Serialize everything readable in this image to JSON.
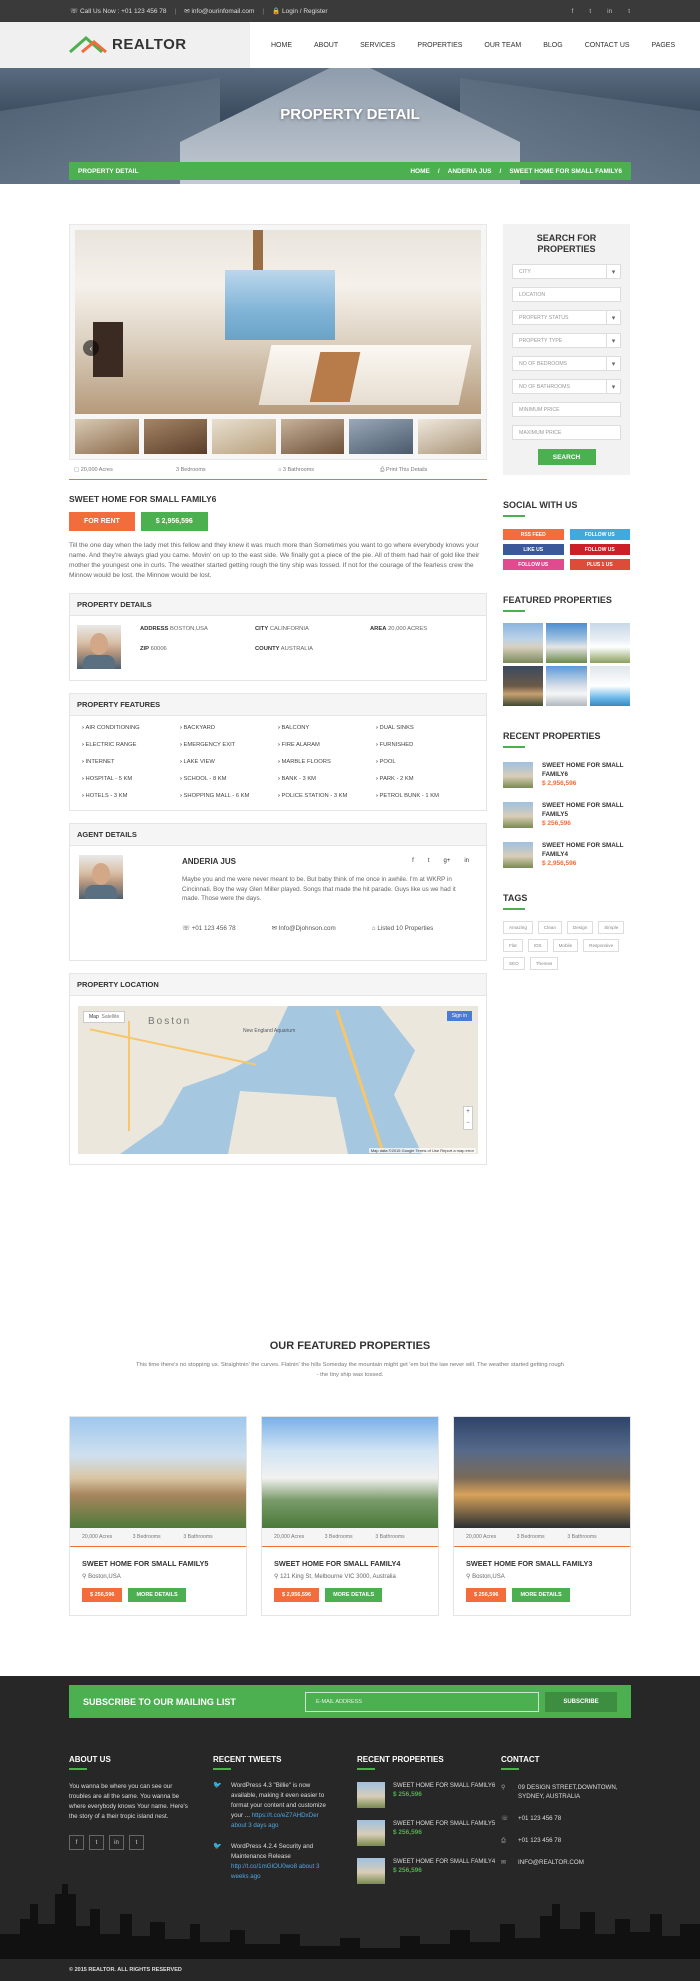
{
  "topbar": {
    "phone": "Call Us Now : +01 123 456 78",
    "email": "info@ourinfomail.com",
    "login": "Login / Register"
  },
  "brand": {
    "name": "REALTOR",
    "green": "#4caf50",
    "orange": "#f36c3c"
  },
  "nav": [
    "HOME",
    "ABOUT",
    "SERVICES",
    "PROPERTIES",
    "OUR TEAM",
    "BLOG",
    "CONTACT US",
    "PAGES"
  ],
  "hero": {
    "title": "PROPERTY DETAIL",
    "bar_label": "PROPERTY DETAIL",
    "breadcrumb": [
      "HOME",
      "ANDERIA JUS",
      "SWEET HOME FOR SMALL FAMILY6"
    ]
  },
  "property": {
    "meta": [
      "20,000 Acres",
      "3 Bedrooms",
      "3 Bathrooms",
      "Print This Details"
    ],
    "title": "SWEET HOME FOR SMALL FAMILY6",
    "status": "FOR RENT",
    "price": "$ 2,956,596",
    "description": "Till the one day when the lady met this fellow and they knew it was much more than Sometimes you want to go where everybody knows your name. And they're always glad you came. Movin' on up to the east side. We finally got a piece of the pie. All of them had hair of gold like their mother the youngest one in curls. The weather started getting rough the tiny ship was tossed. If not for the courage of the fearless crew the Minnow would be lost. the Minnow would be lost."
  },
  "details": {
    "heading": "PROPERTY DETAILS",
    "items": [
      {
        "k": "ADDRESS",
        "v": "BOSTON,USA"
      },
      {
        "k": "CITY",
        "v": "CALINFORNIA"
      },
      {
        "k": "AREA",
        "v": "20,000 ACRES"
      },
      {
        "k": "ZIP",
        "v": "60006"
      },
      {
        "k": "COUNTY",
        "v": "AUSTRALIA"
      }
    ]
  },
  "features": {
    "heading": "PROPERTY FEATURES",
    "items": [
      "AIR CONDITIONING",
      "BACKYARD",
      "BALCONY",
      "DUAL SINKS",
      "ELECTRIC RANGE",
      "EMERGENCY EXIT",
      "FIRE ALARAM",
      "FURNISHED",
      "INTERNET",
      "LAKE VIEW",
      "MARBLE FLOORS",
      "POOL",
      "HOSPITAL - 5 KM",
      "SCHOOL - 8 KM",
      "BANK - 3 KM",
      "PARK - 2 KM",
      "HOTELS - 3 KM",
      "SHOPPING MALL - 6 KM",
      "POLICE STATION - 3 KM",
      "PETROL BUNK - 1 KM"
    ]
  },
  "agent": {
    "heading": "AGENT DETAILS",
    "name": "ANDERIA JUS",
    "social": [
      "f",
      "t",
      "g+",
      "in"
    ],
    "bio": "Maybe you and me were never meant to be. But baby think of me once in awhile. I'm at WKRP in Cincinnati. Boy the way Glen Miller played. Songs that made the hit parade. Guys like us we had it made. Those were the days.",
    "phone": "+01 123 456 78",
    "email": "Info@Djohnson.com",
    "listed": "Listed 10 Properties"
  },
  "location": {
    "heading": "PROPERTY LOCATION",
    "map_btn": "Map",
    "sat_btn": "Satellite",
    "sign_in": "Sign in",
    "city_label": "Boston",
    "place": "New England Aquarium",
    "attribution": "Map data ©2015 Google  Terms of Use  Report a map error"
  },
  "search": {
    "title": "SEARCH FOR PROPERTIES",
    "fields": [
      {
        "label": "CITY",
        "select": true
      },
      {
        "label": "LOCATION",
        "select": false
      },
      {
        "label": "PROPERTY STATUS",
        "select": true
      },
      {
        "label": "PROPERTY TYPE",
        "select": true
      },
      {
        "label": "NO OF BEDROOMS",
        "select": true
      },
      {
        "label": "NO OF BATHROOMS",
        "select": true
      },
      {
        "label": "MINIMUM PRICE",
        "select": false
      },
      {
        "label": "MAXIMUM PRICE",
        "select": false
      }
    ],
    "button": "SEARCH"
  },
  "social": {
    "heading": "SOCIAL WITH US",
    "items": [
      {
        "label": "RSS FEED",
        "color": "#f36c3c"
      },
      {
        "label": "FOLLOW US",
        "color": "#3fa9e0"
      },
      {
        "label": "LIKE US",
        "color": "#3b5998"
      },
      {
        "label": "FOLLOW US",
        "color": "#cb2027"
      },
      {
        "label": "FOLLOW US",
        "color": "#e04a8f"
      },
      {
        "label": "PLUS 1 US",
        "color": "#dd4b39"
      }
    ]
  },
  "featured_side": {
    "heading": "FEATURED PROPERTIES"
  },
  "recent": {
    "heading": "RECENT PROPERTIES",
    "items": [
      {
        "title": "SWEET HOME FOR SMALL FAMILY6",
        "price": "$ 2,956,596"
      },
      {
        "title": "SWEET HOME FOR SMALL FAMILY5",
        "price": "$ 256,596"
      },
      {
        "title": "SWEET HOME FOR SMALL FAMILY4",
        "price": "$ 2,956,596"
      }
    ]
  },
  "tags": {
    "heading": "TAGS",
    "items": [
      "Amazing",
      "Clean",
      "Design",
      "Simple",
      "Flat",
      "IOS",
      "Mobile",
      "Responsive",
      "SEO",
      "Themes"
    ]
  },
  "our_featured": {
    "heading": "OUR FEATURED PROPERTIES",
    "intro": "This time there's no stopping us. Straightnin' the curves. Flatnin' the hills Someday the mountain might get 'em but the law never will. The weather started getting rough - the tiny ship was tossed.",
    "cards": [
      {
        "meta": [
          "20,000 Acres",
          "3 Bedrooms",
          "3 Bathrooms"
        ],
        "title": "SWEET HOME FOR SMALL FAMILY5",
        "address": "Boston,USA",
        "price": "$ 256,596",
        "more": "MORE DETAILS"
      },
      {
        "meta": [
          "20,000 Acres",
          "3 Bedrooms",
          "3 Bathrooms"
        ],
        "title": "SWEET HOME FOR SMALL FAMILY4",
        "address": "121 King St, Melbourne VIC 3000, Australia",
        "price": "$ 2,956,596",
        "more": "MORE DETAILS"
      },
      {
        "meta": [
          "20,000 Acres",
          "3 Bedrooms",
          "3 Bathrooms"
        ],
        "title": "SWEET HOME FOR SMALL FAMILY3",
        "address": "Boston,USA",
        "price": "$ 256,596",
        "more": "MORE DETAILS"
      }
    ]
  },
  "footer": {
    "subscribe_title": "SUBSCRIBE TO OUR MAILING LIST",
    "email_placeholder": "E-MAIL ADDRESS",
    "subscribe_btn": "SUBSCRIBE",
    "about_heading": "ABOUT US",
    "about_text": "You wanna be where you can see our troubles are all the same. You wanna be where everybody knows Your name. Here's the story of a their tropic island nest.",
    "social": [
      "f",
      "t",
      "in",
      "t"
    ],
    "tweets_heading": "RECENT TWEETS",
    "tweets": [
      {
        "text": "WordPress 4.3 \"Billie\" is now available, making it even easier to format your content and customize your ... ",
        "link": "https://t.co/eZ7AHDxDer",
        "time": "about 3 days ago"
      },
      {
        "text": "WordPress 4.2.4 Security and Maintenance Release ",
        "link": "http://t.co/1mGlOU0wo8",
        "time": "about 3 weeks ago"
      }
    ],
    "recent_heading": "RECENT PROPERTIES",
    "recent": [
      {
        "title": "SWEET HOME FOR SMALL FAMILY6",
        "price": "$ 256,596"
      },
      {
        "title": "SWEET HOME FOR SMALL FAMILY5",
        "price": "$ 256,596"
      },
      {
        "title": "SWEET HOME FOR SMALL FAMILY4",
        "price": "$ 256,596"
      }
    ],
    "contact_heading": "CONTACT",
    "address": "09 DESIGN STREET,DOWNTOWN, SYDNEY, AUSTRALIA",
    "phone": "+01 123 456 78",
    "fax": "+01 123 456 78",
    "email": "INFO@REALTOR.COM",
    "copyright": "© 2015 REALTOR. ALL RIGHTS RESERVED"
  }
}
